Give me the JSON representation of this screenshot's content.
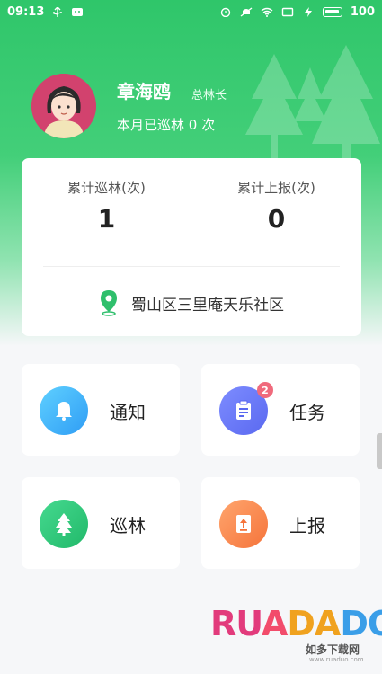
{
  "status_bar": {
    "time": "09:13",
    "battery": "100"
  },
  "profile": {
    "name": "章海鸥",
    "role": "总林长",
    "patrol_this_month": "本月已巡林 0 次"
  },
  "summary": {
    "total_patrols_label": "累计巡林(次)",
    "total_patrols_value": "1",
    "total_reports_label": "累计上报(次)",
    "total_reports_value": "0",
    "location": "蜀山区三里庵天乐社区"
  },
  "menu": {
    "notice": {
      "label": "通知",
      "icon": "bell-icon",
      "color": "#3aa8f7"
    },
    "task": {
      "label": "任务",
      "icon": "clipboard-icon",
      "badge": "2",
      "color": "#6a78f5"
    },
    "patrol": {
      "label": "巡林",
      "icon": "tree-icon",
      "color": "#2bc373"
    },
    "report": {
      "label": "上报",
      "icon": "upload-doc-icon",
      "color": "#f7834a"
    }
  },
  "watermark": {
    "brand": "RUADADO",
    "subtitle": "如多下载网",
    "url": "www.ruaduo.com"
  },
  "colors": {
    "brand_green": "#2fc66a",
    "badge_red": "#f06a7c"
  }
}
